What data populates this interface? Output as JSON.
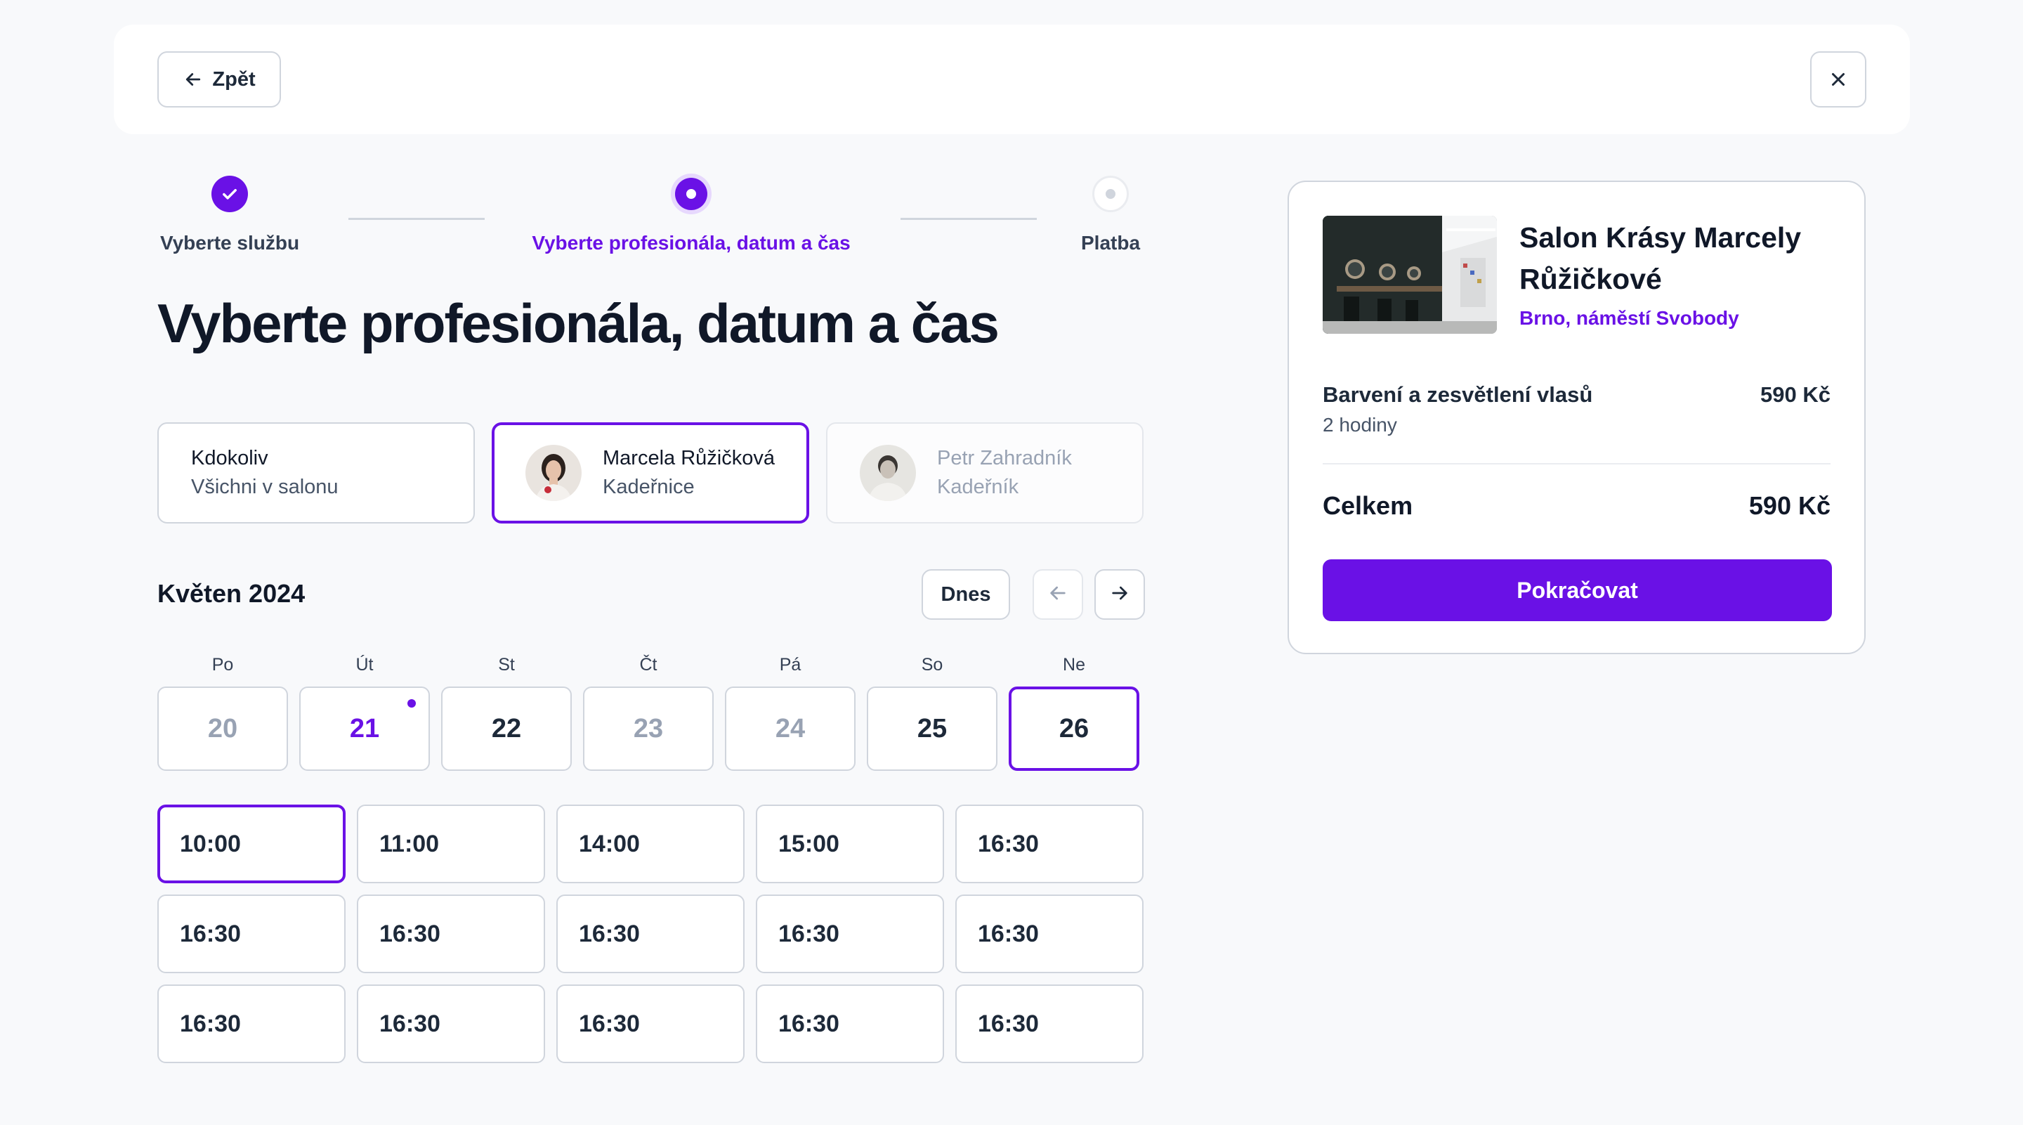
{
  "topbar": {
    "back_label": "Zpět",
    "back_icon": "arrow-left-icon",
    "close_icon": "close-icon"
  },
  "stepper": {
    "steps": [
      {
        "label": "Vyberte službu",
        "status": "done"
      },
      {
        "label": "Vyberte profesionála, datum a čas",
        "status": "active"
      },
      {
        "label": "Platba",
        "status": "todo"
      }
    ]
  },
  "title": "Vyberte profesionála, datum a čas",
  "professionals": [
    {
      "name": "Kdokoliv",
      "role": "Všichni v salonu",
      "selected": false,
      "disabled": false
    },
    {
      "name": "Marcela Růžičková",
      "role": "Kadeřnice",
      "selected": true,
      "disabled": false
    },
    {
      "name": "Petr Zahradník",
      "role": "Kadeřník",
      "selected": false,
      "disabled": true
    }
  ],
  "calendar": {
    "month": "Květen 2024",
    "today_label": "Dnes",
    "weekdays": [
      "Po",
      "Út",
      "St",
      "Čt",
      "Pá",
      "So",
      "Ne"
    ],
    "days": [
      {
        "num": "20",
        "state": "muted"
      },
      {
        "num": "21",
        "state": "today"
      },
      {
        "num": "22",
        "state": "available"
      },
      {
        "num": "23",
        "state": "muted"
      },
      {
        "num": "24",
        "state": "muted"
      },
      {
        "num": "25",
        "state": "available"
      },
      {
        "num": "26",
        "state": "selected"
      }
    ]
  },
  "times": [
    "10:00",
    "11:00",
    "14:00",
    "15:00",
    "16:30",
    "16:30",
    "16:30",
    "16:30",
    "16:30",
    "16:30",
    "16:30",
    "16:30",
    "16:30",
    "16:30",
    "16:30"
  ],
  "selected_time_index": 0,
  "summary": {
    "salon_name": "Salon Krásy Marcely Růžičkové",
    "salon_location": "Brno, náměstí Svobody",
    "service_name": "Barvení a zesvětlení vlasů",
    "service_duration": "2 hodiny",
    "service_price": "590 Kč",
    "total_label": "Celkem",
    "total_value": "590 Kč",
    "continue_label": "Pokračovat"
  },
  "colors": {
    "accent": "#6a11e6",
    "border": "#d0d5dd",
    "text": "#101828",
    "muted_text": "#98a2b3",
    "background": "#f8f9fb"
  }
}
